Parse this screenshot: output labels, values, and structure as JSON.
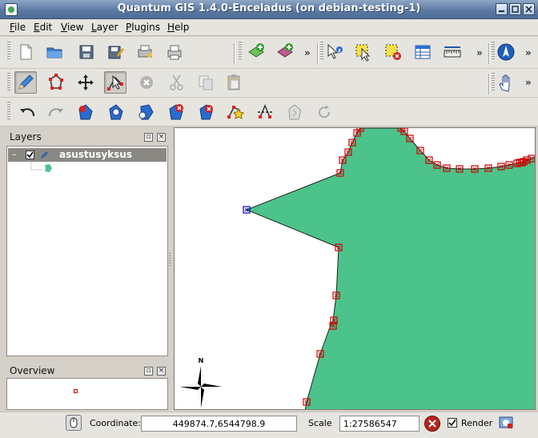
{
  "window": {
    "title": "Quantum GIS 1.4.0-Enceladus (on debian-testing-1)"
  },
  "menu": {
    "items": [
      "File",
      "Edit",
      "View",
      "Layer",
      "Plugins",
      "Help"
    ]
  },
  "toolbar": {
    "overflow_label": "»"
  },
  "layers_panel": {
    "title": "Layers",
    "layer": {
      "name": "asustusyksus",
      "expand_symbol": "–",
      "checked": true,
      "fill_color": "#4cc38a"
    }
  },
  "overview_panel": {
    "title": "Overview"
  },
  "map": {
    "polygon_fill": "#4cc38a",
    "vertex_color": "#cc0000",
    "selected_vertex_color": "#0000cc",
    "north_label": "N"
  },
  "statusbar": {
    "coordinate_label": "Coordinate:",
    "coordinate_value": "449874.7,6544798.9",
    "scale_label": "Scale",
    "scale_value": "1:27586547",
    "render_label": "Render",
    "render_checked": true
  }
}
